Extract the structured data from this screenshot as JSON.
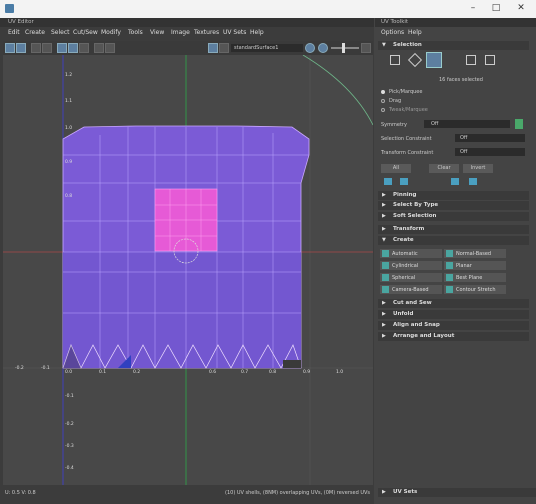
{
  "window": {
    "left_title": "UV Editor",
    "right_title": "UV Toolkit"
  },
  "menu": [
    "Edit",
    "Create",
    "Select",
    "Cut/Sew",
    "Modify",
    "Tools",
    "View",
    "Image",
    "Textures",
    "UV Sets",
    "Help"
  ],
  "toolkit_menu": [
    "Options",
    "Help"
  ],
  "toolbar": {
    "set_name": "standardSurface1"
  },
  "viewport": {
    "x_ticks": [
      "-0.2",
      "0.1",
      "0.2",
      "0.3",
      "0.4",
      "0.5",
      "0.6",
      "0.7",
      "0.8",
      "0.9",
      "1.0",
      "1.1",
      "1.2"
    ],
    "y_ticks": [
      "1.2",
      "1.1",
      "1.0",
      "0.9",
      "0.8",
      "0.7",
      "0.6",
      "0.5",
      "0.4",
      "0.3",
      "0.2",
      "0.1",
      "-0.1",
      "-0.2",
      "-0.3",
      "-0.4",
      "-0.5"
    ],
    "status_left": "U: 0.5 V: 0.8",
    "status_right": "(10) UV shells, (8NM) overlapping UVs, (0M) reversed UVs"
  },
  "toolkit": {
    "selection_header": "Selection",
    "faces_selected": "16 faces selected",
    "radio_options": [
      "Pick/Marquee",
      "Drag",
      "Tweak/Marquee"
    ],
    "symmetry_label": "Symmetry",
    "symmetry_value": "Off",
    "sel_constraint_label": "Selection Constraint",
    "sel_constraint_value": "Off",
    "transform_constraint_label": "Transform Constraint",
    "transform_constraint_value": "Off",
    "all_btn": "All",
    "clear_btn": "Clear",
    "invert_btn": "Invert",
    "sections_collapsed_top": [
      "Pinning",
      "Select By Type",
      "Soft Selection",
      "Transform"
    ],
    "create_header": "Create",
    "create_buttons": [
      "Automatic",
      "Normal-Based",
      "Cylindrical",
      "Planar",
      "Spherical",
      "Best Plane",
      "Camera-Based",
      "Contour Stretch"
    ],
    "sections_collapsed_bottom": [
      "Cut and Sew",
      "Unfold",
      "Align and Snap",
      "Arrange and Layout"
    ],
    "uv_sets": "UV Sets"
  },
  "colors": {
    "mesh": "#7b5bd6",
    "selected_faces": "#e65ad6",
    "panel": "#444444",
    "accent": "#5d7fa0"
  }
}
